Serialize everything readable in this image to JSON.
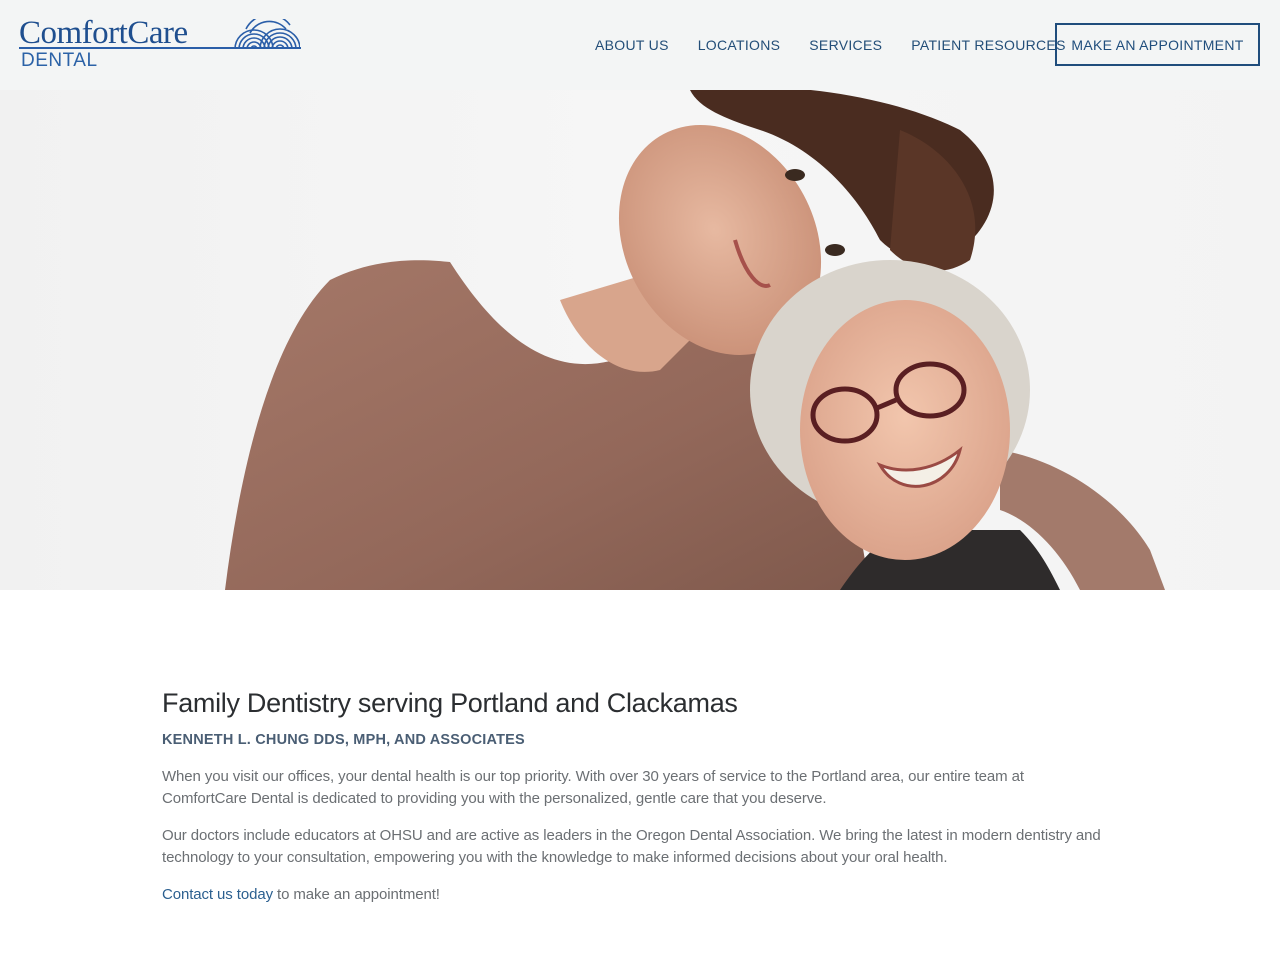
{
  "brand": {
    "name": "ComfortCare",
    "sub": "DENTAL",
    "primary_color": "#1f4f8f",
    "nav_color": "#234e78"
  },
  "nav": {
    "items": [
      {
        "label": "ABOUT US"
      },
      {
        "label": "LOCATIONS"
      },
      {
        "label": "SERVICES"
      },
      {
        "label": "PATIENT RESOURCES"
      }
    ],
    "cta_label": "MAKE AN APPOINTMENT"
  },
  "hero": {
    "image_alt": "Young woman with curly hair smiling, resting her head on a smiling older woman with glasses"
  },
  "main": {
    "title": "Family Dentistry serving Portland and Clackamas",
    "subtitle": "KENNETH L. CHUNG DDS, MPH, AND ASSOCIATES",
    "paragraph1": "When you visit our offices, your dental health is our top priority.  With over 30 years of service to the Portland area, our entire team at ComfortCare Dental is dedicated to providing you with the personalized, gentle care that you deserve.",
    "paragraph2": "Our doctors include educators at OHSU and are active as leaders in the Oregon Dental Association.  We bring the latest in modern dentistry and technology to your consultation, empowering you with the knowledge to make informed decisions about your oral health.",
    "contact_link": "Contact us today",
    "contact_rest": " to make an appointment!"
  }
}
